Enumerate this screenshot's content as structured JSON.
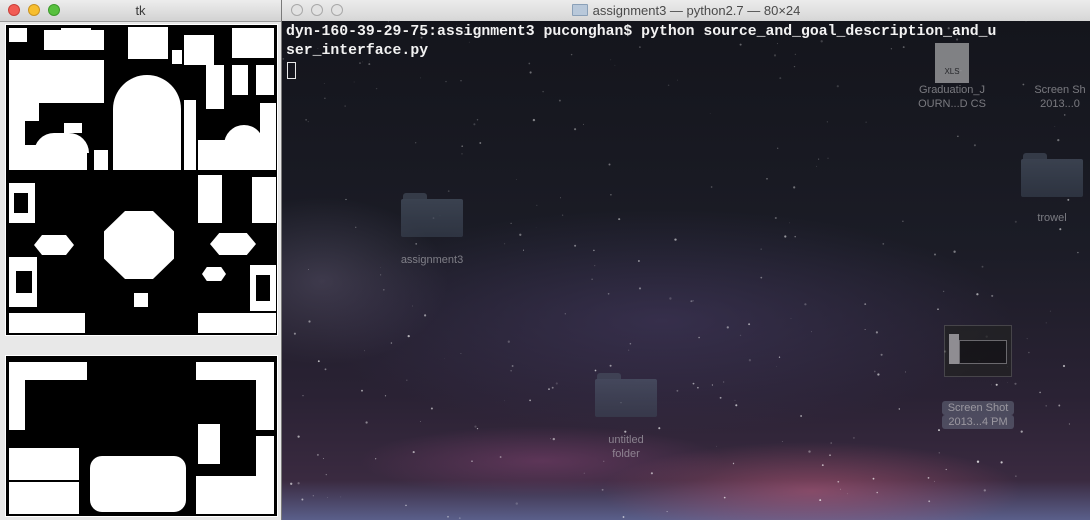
{
  "tk_window": {
    "title": "tk"
  },
  "terminal": {
    "title": "assignment3 — python2.7 — 80×24",
    "lines": [
      "dyn-160-39-29-75:assignment3 puconghan$ python source_and_goal_description_and_u",
      "ser_interface.py"
    ]
  },
  "desktop": {
    "icons": [
      {
        "label_lines": [
          "Graduation_J",
          "OURN...D CS"
        ],
        "kind": "xls-file",
        "badge": "XLS"
      },
      {
        "label_lines": [
          "Screen Sh",
          "2013...0"
        ],
        "kind": "screenshot"
      },
      {
        "label_lines": [
          "trowel"
        ],
        "kind": "folder"
      },
      {
        "label_lines": [
          "assignment3"
        ],
        "kind": "folder"
      },
      {
        "label_lines": [
          "Screen Shot",
          "2013...4 PM"
        ],
        "kind": "screenshot"
      },
      {
        "label_lines": [
          "untitled",
          "folder"
        ],
        "kind": "folder"
      }
    ]
  },
  "colors": {
    "terminal_text": "#f2f2f2",
    "canvas_background": "#000000",
    "obstacle": "#ffffff"
  }
}
